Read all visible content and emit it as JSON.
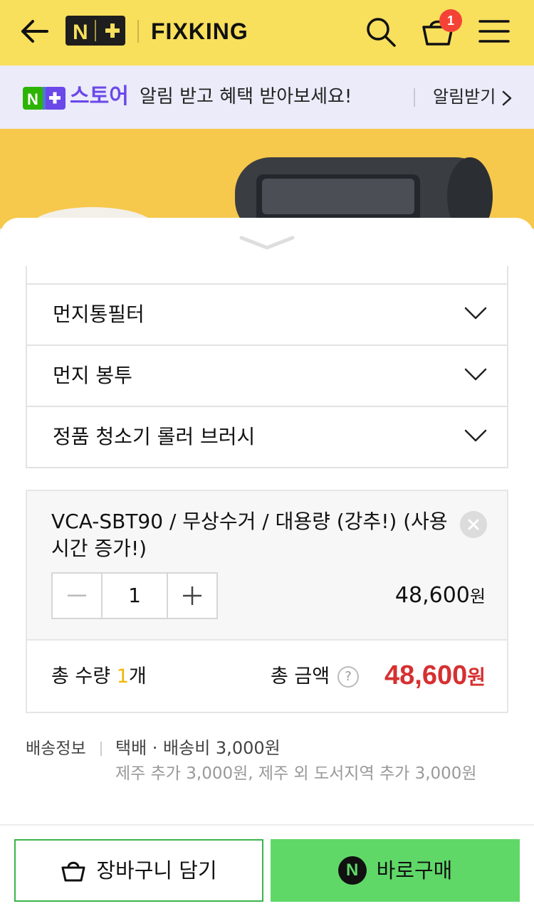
{
  "header": {
    "brand": "FIXKING",
    "cart_count": "1",
    "colors": {
      "background": "#f8df5c",
      "badge": "#f44336"
    }
  },
  "store_banner": {
    "store_name": "스토어",
    "message": "알림 받고 혜택 받아보세요!",
    "link_label": "알림받기",
    "colors": {
      "background": "#ebebfa",
      "store_name": "#6b48e8"
    }
  },
  "options": [
    {
      "label": "먼지통필터"
    },
    {
      "label": "먼지 봉투"
    },
    {
      "label": "정품 청소기 롤러 브러시"
    }
  ],
  "selected_item": {
    "name": "VCA-SBT90 / 무상수거 / 대용량 (강추!) (사용시간 증가!)",
    "quantity": "1",
    "price": "48,600",
    "price_unit": "원"
  },
  "totals": {
    "quantity_label": "총 수량 ",
    "quantity_value": "1",
    "quantity_unit": "개",
    "amount_label": "총 금액",
    "help_glyph": "?",
    "amount_value": "48,600",
    "amount_unit": "원",
    "colors": {
      "quantity": "#f4b400",
      "amount": "#d63031"
    }
  },
  "shipping": {
    "label": "배송정보",
    "main": "택배 · 배송비 3,000원",
    "sub": "제주 추가 3,000원, 제주 외 도서지역 추가 3,000원"
  },
  "actions": {
    "cart_label": "장바구니 담기",
    "buy_label": "바로구매",
    "buy_icon_letter": "N",
    "colors": {
      "buy": "#5fd868",
      "cart_border": "#3bb54a"
    }
  }
}
